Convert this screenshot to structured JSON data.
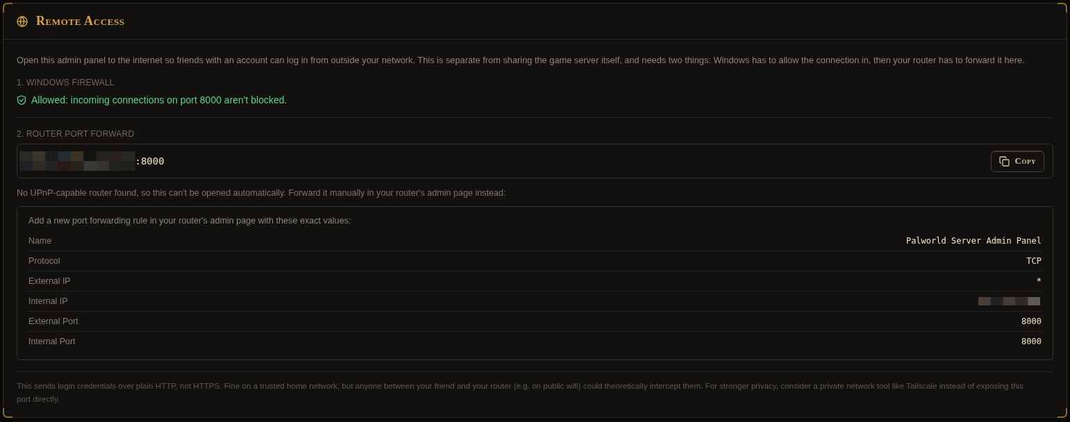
{
  "panel": {
    "title": "Remote Access",
    "intro": "Open this admin panel to the internet so friends with an account can log in from outside your network. This is separate from sharing the game server itself, and needs two things: Windows has to allow the connection in, then your router has to forward it here."
  },
  "firewall": {
    "heading": "1. WINDOWS FIREWALL",
    "status": {
      "kind": "allowed",
      "text": "Allowed: incoming connections on port 8000 aren't blocked."
    }
  },
  "router": {
    "heading": "2. ROUTER PORT FORWARD",
    "address_field": {
      "value": ":8000"
    },
    "copy_button": "Copy",
    "note": "No UPnP-capable router found, so this can't be opened automatically. Forward it manually in your router's admin page instead:",
    "rule_box": {
      "intro": "Add a new port forwarding rule in your router's admin page with these exact values:",
      "rows": [
        {
          "label": "Name",
          "kind": "text",
          "value": "Palworld Server Admin Panel"
        },
        {
          "label": "Protocol",
          "kind": "text",
          "value": "TCP"
        },
        {
          "label": "External IP",
          "kind": "text",
          "value": "*"
        },
        {
          "label": "Internal IP",
          "kind": "redacted"
        },
        {
          "label": "External Port",
          "kind": "text",
          "value": "8000"
        },
        {
          "label": "Internal Port",
          "kind": "text",
          "value": "8000"
        }
      ]
    }
  },
  "footnote": "This sends login credentials over plain HTTP, not HTTPS. Fine on a trusted home network, but anyone between your friend and your router (e.g. on public wifi) could theoretically intercept them. For stronger privacy, consider a private network tool like Tailscale instead of exposing this port directly."
}
